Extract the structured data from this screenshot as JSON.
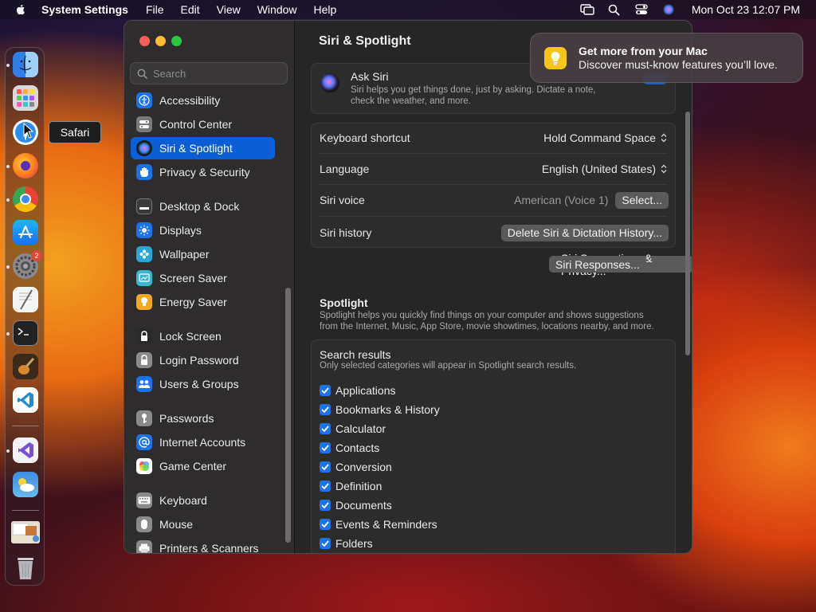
{
  "menubar": {
    "app_name": "System Settings",
    "menus": [
      "File",
      "Edit",
      "View",
      "Window",
      "Help"
    ],
    "clock": "Mon Oct 23  12:07 PM"
  },
  "dock": {
    "tooltip": "Safari",
    "settings_badge": "2",
    "apps": [
      "Finder",
      "Launchpad",
      "Safari",
      "Firefox",
      "Chrome",
      "App Store",
      "System Settings",
      "TextEdit",
      "Terminal",
      "Instruments",
      "Visual Studio Code",
      "Visual Studio",
      "Weather",
      "Downloads",
      "Trash"
    ]
  },
  "sidebar": {
    "search_placeholder": "Search",
    "items": [
      {
        "label": "Accessibility",
        "color": "#1a73e8"
      },
      {
        "label": "Control Center",
        "color": "#7a7a7a"
      },
      {
        "label": "Siri & Spotlight",
        "color": "#222222",
        "selected": true
      },
      {
        "label": "Privacy & Security",
        "color": "#1a73e8"
      },
      {
        "label": "Desktop & Dock",
        "color": "#3a3a3a"
      },
      {
        "label": "Displays",
        "color": "#1a73e8"
      },
      {
        "label": "Wallpaper",
        "color": "#2aa7d8"
      },
      {
        "label": "Screen Saver",
        "color": "#37b7d0"
      },
      {
        "label": "Energy Saver",
        "color": "#f5a623"
      },
      {
        "label": "Lock Screen",
        "color": "#2a2a2a"
      },
      {
        "label": "Login Password",
        "color": "#8a8a8a"
      },
      {
        "label": "Users & Groups",
        "color": "#1a73e8"
      },
      {
        "label": "Passwords",
        "color": "#8a8a8a"
      },
      {
        "label": "Internet Accounts",
        "color": "#1a73e8"
      },
      {
        "label": "Game Center",
        "color": "#ffffff"
      },
      {
        "label": "Keyboard",
        "color": "#8a8a8a"
      },
      {
        "label": "Mouse",
        "color": "#8a8a8a"
      },
      {
        "label": "Printers & Scanners",
        "color": "#8a8a8a"
      }
    ]
  },
  "content": {
    "title": "Siri & Spotlight",
    "ask_siri": {
      "title": "Ask Siri",
      "desc_line1": "Siri helps you get things done, just by asking. Dictate a note,",
      "desc_line2": "check the weather, and more."
    },
    "settings": {
      "keyboard_shortcut_label": "Keyboard shortcut",
      "keyboard_shortcut_value": "Hold Command Space",
      "language_label": "Language",
      "language_value": "English (United States)",
      "siri_voice_label": "Siri voice",
      "siri_voice_value": "American (Voice 1)",
      "siri_voice_button": "Select...",
      "siri_history_label": "Siri history",
      "siri_history_button": "Delete Siri & Dictation History..."
    },
    "buttons": {
      "suggestions_privacy": "Siri Suggestions & Privacy...",
      "responses": "Siri Responses..."
    },
    "spotlight": {
      "title": "Spotlight",
      "desc_line1": "Spotlight helps you quickly find things on your computer and shows suggestions",
      "desc_line2": "from the Internet, Music, App Store, movie showtimes, locations nearby, and more."
    },
    "search_results": {
      "title": "Search results",
      "desc": "Only selected categories will appear in Spotlight search results.",
      "categories": [
        "Applications",
        "Bookmarks & History",
        "Calculator",
        "Contacts",
        "Conversion",
        "Definition",
        "Documents",
        "Events & Reminders",
        "Folders"
      ]
    }
  },
  "notification": {
    "title": "Get more from your Mac",
    "body": "Discover must-know features you’ll love."
  }
}
